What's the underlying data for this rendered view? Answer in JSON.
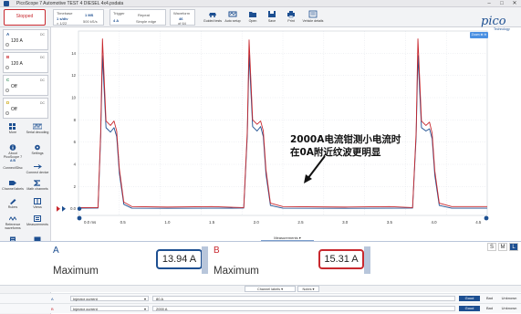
{
  "window": {
    "title": "PicoScope 7 Automotive TEST 4 DIESEL 4x4.psdata"
  },
  "toolbar": {
    "stop_label": "Stopped",
    "timebase": {
      "label": "Timebase",
      "value": "1 s/div",
      "sub": "× 1/22"
    },
    "samples": {
      "value": "1 MS",
      "sub": "500 kS/s"
    },
    "trigger": {
      "label": "Trigger",
      "mode": "Repeat",
      "channel": "A",
      "level": "4 A",
      "sub": "Simple edge"
    },
    "waveform": {
      "label": "Waveform",
      "value": "46",
      "sub": "of 64"
    },
    "buttons": [
      {
        "name": "guided-tests",
        "label": "Guided tests"
      },
      {
        "name": "auto-setup",
        "label": "Auto setup"
      },
      {
        "name": "open",
        "label": "Open"
      },
      {
        "name": "save",
        "label": "Save"
      },
      {
        "name": "print",
        "label": "Print"
      },
      {
        "name": "vehicle-details",
        "label": "Vehicle details"
      }
    ],
    "logo": {
      "text": "pico",
      "sub": "Technology"
    }
  },
  "channels": [
    {
      "letter": "A",
      "range": "120 A",
      "coupling": "DC",
      "color": "#1d4f91"
    },
    {
      "letter": "B",
      "range": "120 A",
      "coupling": "DC",
      "color": "#c8282e"
    },
    {
      "letter": "C",
      "range": "Off",
      "coupling": "DC",
      "color": "#2e8b57"
    },
    {
      "letter": "D",
      "range": "Off",
      "coupling": "DC",
      "color": "#c8a000"
    }
  ],
  "tools": [
    {
      "name": "more",
      "label": "More"
    },
    {
      "name": "serial-decoding",
      "label": "Serial decoding"
    },
    {
      "name": "about",
      "label": "About PicoScope 7"
    },
    {
      "name": "settings",
      "label": "Settings"
    },
    {
      "name": "connect-device",
      "label": "Connect device"
    },
    {
      "name": "channel-labels",
      "label": "Channel labels"
    },
    {
      "name": "math-channels",
      "label": "Math channels"
    },
    {
      "name": "rulers",
      "label": "Rulers"
    },
    {
      "name": "views",
      "label": "Views"
    },
    {
      "name": "reference-waveforms",
      "label": "Reference waveforms"
    },
    {
      "name": "measurements",
      "label": "Measurements"
    },
    {
      "name": "notes",
      "label": "Notes"
    },
    {
      "name": "send-feedback",
      "label": "Send feedback"
    }
  ],
  "tools_extra": {
    "connect_label": "Connect/Disc",
    "badge": "A B"
  },
  "scope": {
    "zoom_label": "Zoom ⊕ ⊖"
  },
  "chart_data": {
    "type": "line",
    "x_unit": "ms",
    "xlim": [
      0,
      4.6
    ],
    "ylim": [
      -0.6,
      16
    ],
    "x_ticks": [
      "0.0 ms",
      "0.5",
      "1.0",
      "1.5",
      "2.0",
      "2.5",
      "3.0",
      "3.5",
      "4.0",
      "4.5"
    ],
    "y_ticks": [
      "14",
      "12",
      "10",
      "8",
      "6",
      "4",
      "2",
      "0.0",
      "0"
    ],
    "grid": true,
    "series": [
      {
        "channel": "A",
        "color": "#1d4f91",
        "points": [
          [
            0,
            0.05
          ],
          [
            0.22,
            0.06
          ],
          [
            0.25,
            6.5
          ],
          [
            0.27,
            13.8
          ],
          [
            0.31,
            7.3
          ],
          [
            0.36,
            6.9
          ],
          [
            0.4,
            7.3
          ],
          [
            0.43,
            6.5
          ],
          [
            0.46,
            3.2
          ],
          [
            0.51,
            0.4
          ],
          [
            0.6,
            0.05
          ],
          [
            1.0,
            0.04
          ],
          [
            1.5,
            0.05
          ],
          [
            1.86,
            0.06
          ],
          [
            1.9,
            6.6
          ],
          [
            1.92,
            13.9
          ],
          [
            1.96,
            7.4
          ],
          [
            2.01,
            7.0
          ],
          [
            2.05,
            7.4
          ],
          [
            2.08,
            6.5
          ],
          [
            2.11,
            3.1
          ],
          [
            2.16,
            0.3
          ],
          [
            2.3,
            0.05
          ],
          [
            3.0,
            0.04
          ],
          [
            3.5,
            0.05
          ],
          [
            3.76,
            0.06
          ],
          [
            3.8,
            6.5
          ],
          [
            3.82,
            13.8
          ],
          [
            3.86,
            7.3
          ],
          [
            3.91,
            7.0
          ],
          [
            3.95,
            7.2
          ],
          [
            3.98,
            6.3
          ],
          [
            4.01,
            3.0
          ],
          [
            4.06,
            0.3
          ],
          [
            4.2,
            0.05
          ],
          [
            4.6,
            0.05
          ]
        ]
      },
      {
        "channel": "B",
        "color": "#c8282e",
        "points": [
          [
            0,
            0.1
          ],
          [
            0.22,
            0.1
          ],
          [
            0.25,
            6.9
          ],
          [
            0.27,
            15.3
          ],
          [
            0.31,
            7.9
          ],
          [
            0.36,
            7.5
          ],
          [
            0.4,
            7.9
          ],
          [
            0.43,
            7.0
          ],
          [
            0.46,
            3.6
          ],
          [
            0.51,
            0.6
          ],
          [
            0.6,
            0.2
          ],
          [
            1.0,
            0.15
          ],
          [
            1.5,
            0.2
          ],
          [
            1.86,
            0.1
          ],
          [
            1.9,
            7.0
          ],
          [
            1.92,
            15.2
          ],
          [
            1.96,
            8.0
          ],
          [
            2.01,
            7.6
          ],
          [
            2.05,
            7.9
          ],
          [
            2.08,
            7.0
          ],
          [
            2.11,
            3.5
          ],
          [
            2.16,
            0.5
          ],
          [
            2.3,
            0.2
          ],
          [
            3.0,
            0.15
          ],
          [
            3.5,
            0.2
          ],
          [
            3.76,
            0.1
          ],
          [
            3.8,
            6.9
          ],
          [
            3.82,
            15.3
          ],
          [
            3.86,
            7.9
          ],
          [
            3.91,
            7.5
          ],
          [
            3.95,
            7.8
          ],
          [
            3.98,
            6.8
          ],
          [
            4.01,
            3.4
          ],
          [
            4.06,
            0.5
          ],
          [
            4.2,
            0.2
          ],
          [
            4.6,
            0.2
          ]
        ]
      }
    ]
  },
  "annotation": {
    "line1": "2000A电流钳测小电流时",
    "line2": "在0A附近纹波更明显"
  },
  "measurements": {
    "tab_label": "Measurements",
    "items": [
      {
        "channel": "A",
        "name": "Maximum",
        "value": "13.94 A",
        "color": "#1d4f91"
      },
      {
        "channel": "B",
        "name": "Maximum",
        "value": "15.31 A",
        "color": "#c8282e"
      }
    ],
    "size_buttons": [
      "S",
      "M",
      "L"
    ]
  },
  "bottom": {
    "tabs": [
      "Channel labels",
      "Notes"
    ],
    "rows": [
      {
        "letter": "A",
        "probe": "Injector current",
        "note": "80 A",
        "good": "Good",
        "bad": "Bad",
        "unknown": "Unknown"
      },
      {
        "letter": "B",
        "probe": "Injector current",
        "note": "2000 A",
        "good": "Good",
        "bad": "Bad",
        "unknown": "Unknown"
      }
    ]
  }
}
